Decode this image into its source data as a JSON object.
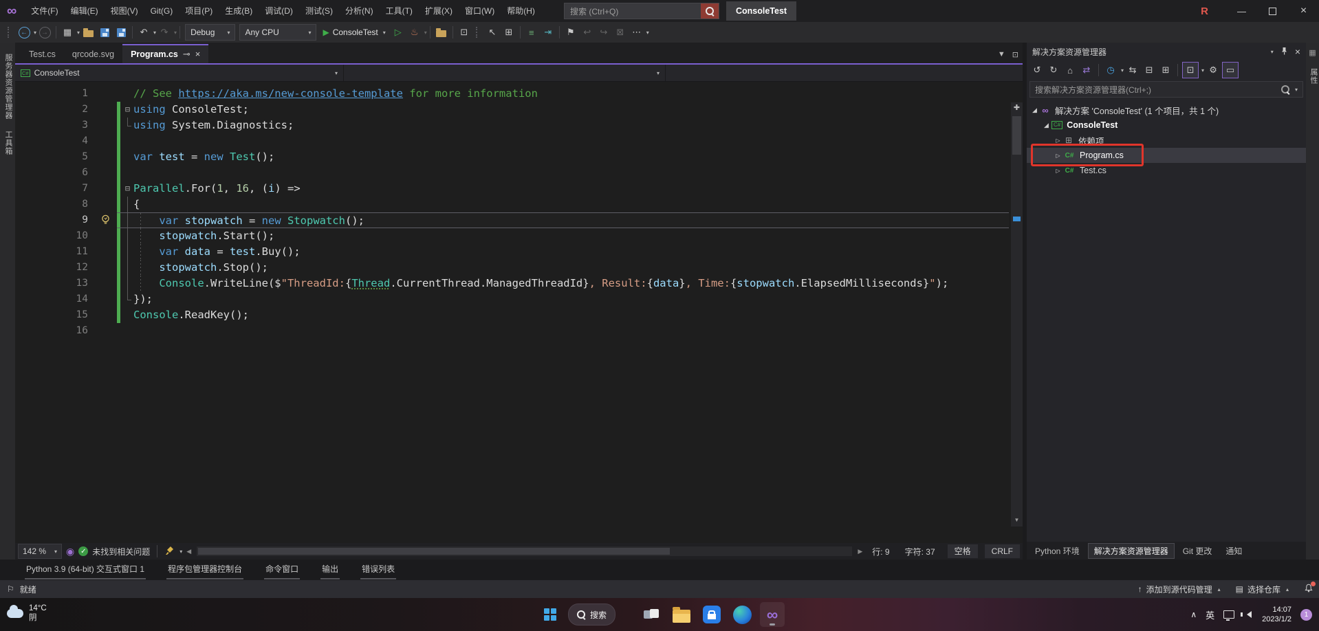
{
  "titlebar": {
    "menus": [
      "文件(F)",
      "编辑(E)",
      "视图(V)",
      "Git(G)",
      "项目(P)",
      "生成(B)",
      "调试(D)",
      "测试(S)",
      "分析(N)",
      "工具(T)",
      "扩展(X)",
      "窗口(W)",
      "帮助(H)"
    ],
    "search_placeholder": "搜索 (Ctrl+Q)",
    "window_title": "ConsoleTest",
    "resharper_logo": "R"
  },
  "toolbar": {
    "config": "Debug",
    "platform": "Any CPU",
    "run_target": "ConsoleTest"
  },
  "left_strip": [
    "服务器资源管理器",
    "工具箱"
  ],
  "right_strip": "属性",
  "editor": {
    "tabs": [
      {
        "label": "Test.cs",
        "active": false
      },
      {
        "label": "qrcode.svg",
        "active": false
      },
      {
        "label": "Program.cs",
        "active": true
      }
    ],
    "breadcrumb": "ConsoleTest",
    "zoom_level": "142 %",
    "health": "未找到相关问题",
    "line_info": {
      "line": "行: 9",
      "col": "字符: 37",
      "spaces": "空格",
      "eol": "CRLF"
    },
    "lines": [
      {
        "n": 1,
        "tokens": [
          [
            "cmt",
            "// See "
          ],
          [
            "link",
            "https://aka.ms/new-console-template"
          ],
          [
            "cmt",
            " for more information"
          ]
        ]
      },
      {
        "n": 2,
        "fold": "box",
        "chg": true,
        "tokens": [
          [
            "kw",
            "using"
          ],
          [
            "id",
            " ConsoleTest;"
          ]
        ]
      },
      {
        "n": 3,
        "fold": "corner",
        "chg": true,
        "tokens": [
          [
            "kw",
            "using"
          ],
          [
            "id",
            " System.Diagnostics;"
          ]
        ]
      },
      {
        "n": 4,
        "chg": true,
        "tokens": []
      },
      {
        "n": 5,
        "chg": true,
        "tokens": [
          [
            "kw",
            "var"
          ],
          [
            "var",
            " test"
          ],
          [
            "id",
            " = "
          ],
          [
            "kw",
            "new"
          ],
          [
            "cls",
            " Test"
          ],
          [
            "id",
            "();"
          ]
        ]
      },
      {
        "n": 6,
        "chg": true,
        "tokens": []
      },
      {
        "n": 7,
        "fold": "box",
        "chg": true,
        "tokens": [
          [
            "cls",
            "Parallel"
          ],
          [
            "id",
            ".For("
          ],
          [
            "num",
            "1"
          ],
          [
            "id",
            ", "
          ],
          [
            "num",
            "16"
          ],
          [
            "id",
            ", ("
          ],
          [
            "var",
            "i"
          ],
          [
            "id",
            ") =>"
          ]
        ]
      },
      {
        "n": 8,
        "fold": "line",
        "chg": true,
        "tokens": [
          [
            "id",
            "{"
          ]
        ]
      },
      {
        "n": 9,
        "fold": "line",
        "chg": true,
        "cur": true,
        "bulb": true,
        "guide": true,
        "tokens": [
          [
            "id",
            "    "
          ],
          [
            "kw",
            "var"
          ],
          [
            "var",
            " stopwatch"
          ],
          [
            "id",
            " = "
          ],
          [
            "kw",
            "new"
          ],
          [
            "cls",
            " Stopwatch"
          ],
          [
            "id",
            "();"
          ]
        ]
      },
      {
        "n": 10,
        "fold": "line",
        "chg": true,
        "guide": true,
        "tokens": [
          [
            "id",
            "    "
          ],
          [
            "var",
            "stopwatch"
          ],
          [
            "id",
            ".Start();"
          ]
        ]
      },
      {
        "n": 11,
        "fold": "line",
        "chg": true,
        "guide": true,
        "tokens": [
          [
            "id",
            "    "
          ],
          [
            "kw",
            "var"
          ],
          [
            "var",
            " data"
          ],
          [
            "id",
            " = "
          ],
          [
            "var",
            "test"
          ],
          [
            "id",
            ".Buy();"
          ]
        ]
      },
      {
        "n": 12,
        "fold": "line",
        "chg": true,
        "guide": true,
        "tokens": [
          [
            "id",
            "    "
          ],
          [
            "var",
            "stopwatch"
          ],
          [
            "id",
            ".Stop();"
          ]
        ]
      },
      {
        "n": 13,
        "fold": "line",
        "chg": true,
        "guide": true,
        "tokens": [
          [
            "id",
            "    "
          ],
          [
            "cls",
            "Console"
          ],
          [
            "id",
            ".WriteLine($"
          ],
          [
            "str",
            "\"ThreadId:"
          ],
          [
            "id",
            "{"
          ],
          [
            "clsu",
            "Thread"
          ],
          [
            "id",
            ".CurrentThread.ManagedThreadId}"
          ],
          [
            "str",
            ", Result:"
          ],
          [
            "id",
            "{"
          ],
          [
            "var",
            "data"
          ],
          [
            "id",
            "}"
          ],
          [
            "str",
            ", Time:"
          ],
          [
            "id",
            "{"
          ],
          [
            "var",
            "stopwatch"
          ],
          [
            "id",
            ".ElapsedMilliseconds}"
          ],
          [
            "str",
            "\""
          ],
          [
            "id",
            ");"
          ]
        ]
      },
      {
        "n": 14,
        "fold": "corner",
        "chg": true,
        "tokens": [
          [
            "id",
            "});"
          ]
        ]
      },
      {
        "n": 15,
        "chg": true,
        "tokens": [
          [
            "cls",
            "Console"
          ],
          [
            "id",
            ".ReadKey();"
          ]
        ]
      },
      {
        "n": 16,
        "tokens": []
      }
    ]
  },
  "solution_explorer": {
    "title": "解决方案资源管理器",
    "search_placeholder": "搜索解决方案资源管理器(Ctrl+;)",
    "rows": [
      {
        "icon": "sln",
        "arrow": "exp",
        "indent": 0,
        "label": "解决方案 'ConsoleTest' (1 个项目，共 1 个)"
      },
      {
        "icon": "proj",
        "arrow": "exp",
        "indent": 1,
        "label": "ConsoleTest",
        "bold": true
      },
      {
        "icon": "deps",
        "arrow": "col",
        "indent": 2,
        "label": "依赖项"
      },
      {
        "icon": "cs",
        "arrow": "col",
        "indent": 2,
        "label": "Program.cs",
        "selected": true,
        "annotated": true
      },
      {
        "icon": "cs",
        "arrow": "col",
        "indent": 2,
        "label": "Test.cs"
      }
    ],
    "dock_tabs": [
      {
        "label": "Python 环境",
        "active": false
      },
      {
        "label": "解决方案资源管理器",
        "active": true
      },
      {
        "label": "Git 更改",
        "active": false
      },
      {
        "label": "通知",
        "active": false
      }
    ]
  },
  "bottom_tabs": [
    "Python 3.9 (64-bit) 交互式窗口 1",
    "程序包管理器控制台",
    "命令窗口",
    "输出",
    "错误列表"
  ],
  "statusbar": {
    "ready": "就绪",
    "add_to_source": "添加到源代码管理",
    "select_repo": "选择仓库"
  },
  "taskbar": {
    "weather_temp": "14°C",
    "weather_cond": "阴",
    "search_label": "搜索",
    "ime": "英",
    "time": "14:07",
    "date": "2023/1/2",
    "badge": "1"
  },
  "icons": {
    "fold_box": "⊟",
    "tree_expanded": "◢",
    "tree_collapsed": "▷",
    "caret": "▾"
  }
}
